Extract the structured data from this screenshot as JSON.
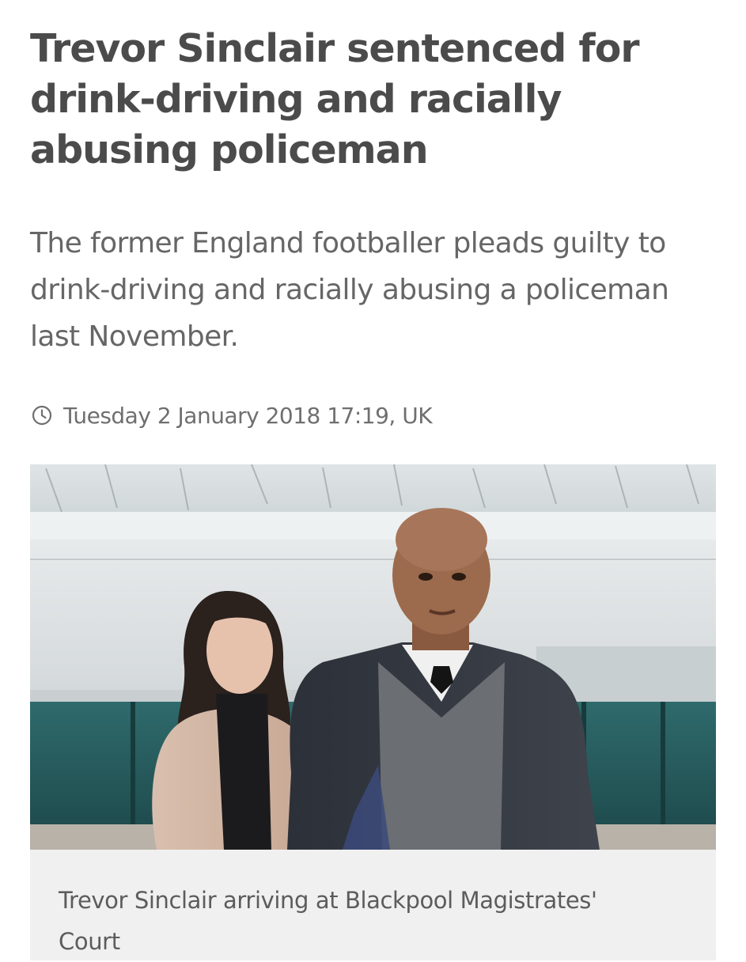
{
  "article": {
    "headline": "Trevor Sinclair sentenced for drink-driving and racially abusing policeman",
    "standfirst": "The former England footballer pleads guilty to drink-driving and racially abusing a policeman last November.",
    "timestamp": "Tuesday 2 January 2018 17:19, UK",
    "timestamp_icon": "clock-icon",
    "image": {
      "caption": "Trevor Sinclair arriving at Blackpool Magistrates' Court"
    }
  },
  "colors": {
    "headline": "#4b4b4b",
    "standfirst": "#666666",
    "meta": "#6f6f6f",
    "caption_background": "#f0f0f0"
  }
}
